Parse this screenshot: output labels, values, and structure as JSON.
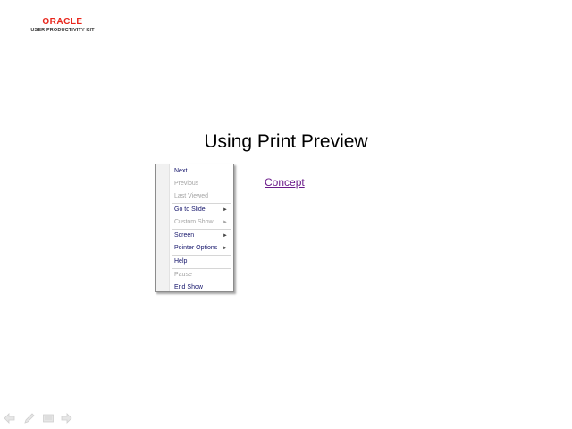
{
  "logo": {
    "brand": "ORACLE",
    "subtitle": "USER PRODUCTIVITY KIT"
  },
  "slide": {
    "title": "Using Print Preview",
    "link": "Concept"
  },
  "context_menu": {
    "items": [
      {
        "label": "Next",
        "enabled": true,
        "submenu": false
      },
      {
        "label": "Previous",
        "enabled": false,
        "submenu": false
      },
      {
        "label": "Last Viewed",
        "enabled": false,
        "submenu": false
      },
      {
        "label": "Go to Slide",
        "enabled": true,
        "submenu": true
      },
      {
        "label": "Custom Show",
        "enabled": false,
        "submenu": true
      },
      {
        "label": "Screen",
        "enabled": true,
        "submenu": true
      },
      {
        "label": "Pointer Options",
        "enabled": true,
        "submenu": true
      },
      {
        "label": "Help",
        "enabled": true,
        "submenu": false
      },
      {
        "label": "Pause",
        "enabled": false,
        "submenu": false
      },
      {
        "label": "End Show",
        "enabled": true,
        "submenu": false
      }
    ]
  },
  "nav_controls": {
    "icons": [
      "previous-arrow-icon",
      "pen-icon",
      "slide-menu-icon",
      "next-arrow-icon"
    ]
  },
  "colors": {
    "brand_red": "#e8251b",
    "link_purple": "#6a1a8a",
    "menu_text": "#15156b",
    "menu_disabled": "#a4a4a4"
  }
}
